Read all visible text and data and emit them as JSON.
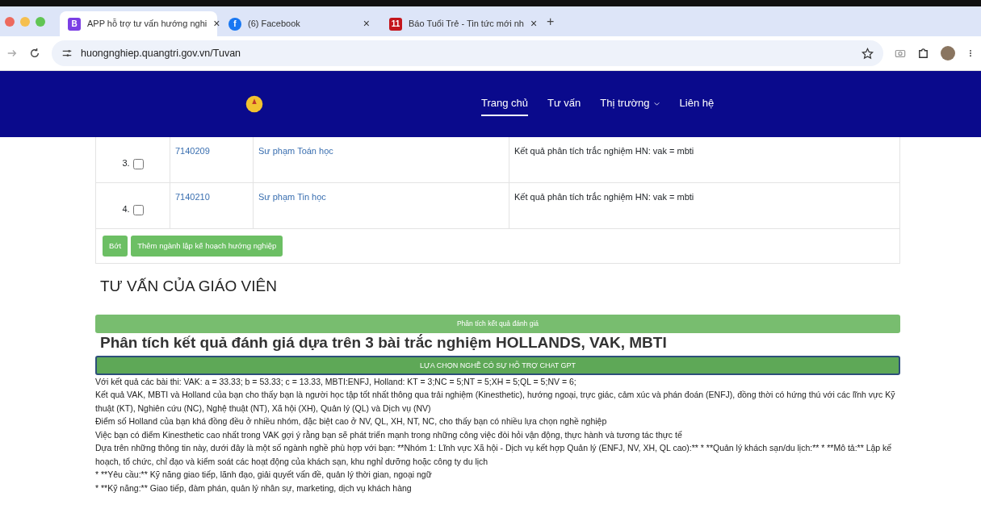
{
  "browser": {
    "tabs": [
      {
        "title": "APP hỗ trợ tư vấn hướng nghi",
        "favicon": "B",
        "selected": true
      },
      {
        "title": "(6) Facebook",
        "favicon": "f",
        "selected": false
      },
      {
        "title": "Báo Tuổi Trẻ - Tin tức mới nh",
        "favicon": "11",
        "selected": false
      }
    ],
    "new_tab": "+",
    "close": "×",
    "url": "huongnghiep.quangtri.gov.vn/Tuvan"
  },
  "navbar": {
    "items": [
      {
        "label": "Trang chủ",
        "selected": true,
        "dropdown": false
      },
      {
        "label": "Tư vấn",
        "selected": false,
        "dropdown": false
      },
      {
        "label": "Thị trường",
        "selected": false,
        "dropdown": true
      },
      {
        "label": "Liên hệ",
        "selected": false,
        "dropdown": false
      }
    ]
  },
  "table": {
    "rows": [
      {
        "index": "3.",
        "checked": false,
        "code": "7140209",
        "name": "Sư phạm Toán học",
        "result": "Kết quả phân tích trắc nghiệm HN: vak = mbti"
      },
      {
        "index": "4.",
        "checked": false,
        "code": "7140210",
        "name": "Sư phạm Tin học",
        "result": "Kết quả phân tích trắc nghiệm HN: vak = mbti"
      }
    ],
    "buttons": [
      "Bớt",
      "Thêm ngành lập kế hoạch hướng nghiệp"
    ]
  },
  "teacher": {
    "heading": "TƯ VẤN CỦA GIÁO VIÊN",
    "bar": "Phân tích kết quả đánh giá",
    "title": "Phân tích kết quả đánh giá dựa trên 3 bài trắc nghiệm HOLLANDS, VAK, MBTI",
    "gpt_button": "LỰA CHỌN NGHỀ CÓ SỰ HỖ TRỢ CHAT GPT",
    "lines": [
      "Với kết quả các bài thi: VAK: a = 33.33; b = 53.33; c = 13.33, MBTI:ENFJ, Holland: KT = 3;NC = 5;NT = 5;XH = 5;QL = 5;NV = 6;",
      "Kết quả VAK, MBTI và Holland của bạn cho thấy bạn là người học tập tốt nhất thông qua trải nghiệm (Kinesthetic), hướng ngoại, trực giác, cảm xúc và phán đoán (ENFJ), đồng thời có hứng thú với các lĩnh vực Kỹ thuật (KT), Nghiên cứu (NC), Nghệ thuật (NT), Xã hội (XH), Quản lý (QL) và Dịch vụ (NV)",
      "Điểm số Holland của bạn khá đồng đều ở nhiều nhóm, đặc biệt cao ở NV, QL, XH, NT, NC, cho thấy bạn có nhiều lựa chọn nghề nghiệp",
      "Việc bạn có điểm Kinesthetic cao nhất trong VAK gợi ý rằng bạn sẽ phát triển mạnh trong những công việc đòi hỏi vận động, thực hành và tương tác thực tế",
      "Dựa trên những thông tin này, dưới đây là một số ngành nghề phù hợp với bạn: **Nhóm 1: Lĩnh vực Xã hội - Dịch vụ kết hợp Quản lý (ENFJ, NV, XH, QL cao):** * **Quản lý khách sạn/du lịch:** * **Mô tả:** Lập kế hoạch, tổ chức, chỉ đạo và kiểm soát các hoạt động của khách sạn, khu nghỉ dưỡng hoặc công ty du lịch",
      "* **Yêu cầu:** Kỹ năng giao tiếp, lãnh đạo, giải quyết vấn đề, quản lý thời gian, ngoại ngữ",
      "* **Kỹ năng:** Giao tiếp, đàm phán, quản lý nhân sự, marketing, dịch vụ khách hàng"
    ]
  }
}
